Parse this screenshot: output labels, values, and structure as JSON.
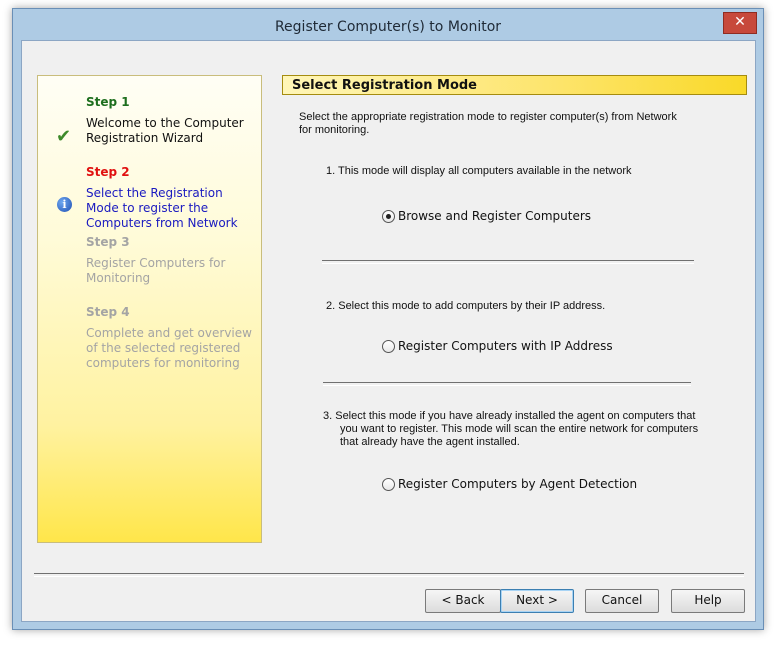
{
  "window": {
    "title": "Register Computer(s) to Monitor",
    "close_glyph": "✕"
  },
  "sidebar": {
    "steps": [
      {
        "head": "Step 1",
        "desc": "Welcome to the Computer Registration Wizard",
        "status": "done",
        "icon": "check-icon"
      },
      {
        "head": "Step 2",
        "desc": "Select the Registration Mode to register the Computers from Network",
        "status": "active",
        "icon": "info-icon"
      },
      {
        "head": "Step 3",
        "desc": "Register Computers for Monitoring",
        "status": "pending"
      },
      {
        "head": "Step 4",
        "desc": "Complete and get overview of the selected registered computers for monitoring",
        "status": "pending"
      }
    ],
    "check_glyph": "✔",
    "info_glyph": "i"
  },
  "main": {
    "header": "Select Registration Mode",
    "intro": "Select the appropriate registration mode to register computer(s) from Network for monitoring.",
    "modes": [
      {
        "description": "1.  This mode will display all computers available in the  network",
        "option": "Browse and Register Computers",
        "selected": true
      },
      {
        "description": "2.  Select this mode to add computers by their IP address.",
        "option": "Register Computers with IP Address",
        "selected": false
      },
      {
        "description": "3.  Select this mode if you have already installed the agent on computers that you want to register. This mode will scan the entire network for computers that already have the agent installed.",
        "option": "Register Computers by Agent Detection",
        "selected": false
      }
    ]
  },
  "buttons": {
    "back": "< Back",
    "next": "Next >",
    "cancel": "Cancel",
    "help": "Help"
  },
  "colors": {
    "accent_yellow": "#f9d928",
    "active_step": "#e01010",
    "link_blue": "#1a1ac0",
    "done_step": "#1d6e1d"
  }
}
